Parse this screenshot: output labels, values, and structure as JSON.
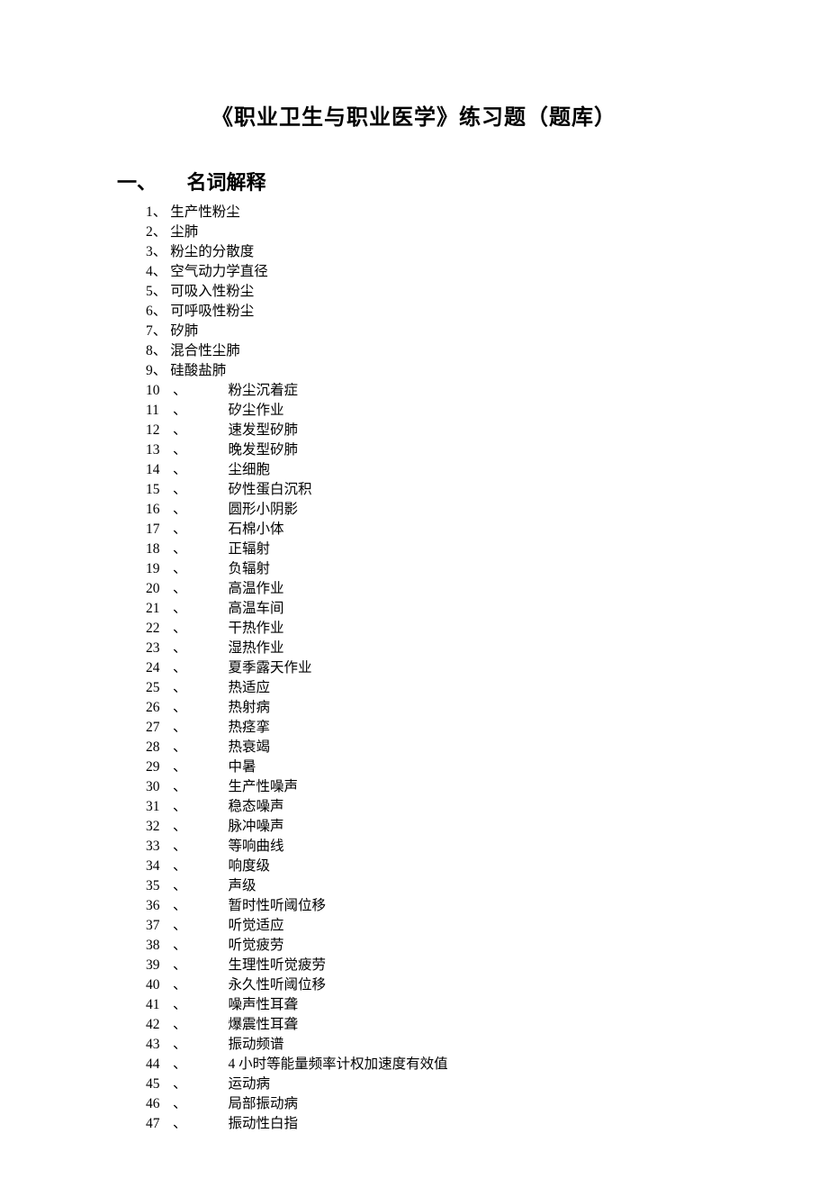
{
  "title": "《职业卫生与职业医学》练习题（题库）",
  "section": {
    "number": "一、",
    "label": "名词解释"
  },
  "items": [
    {
      "n": "1",
      "t": "生产性粉尘",
      "style": "a"
    },
    {
      "n": "2",
      "t": "尘肺",
      "style": "a"
    },
    {
      "n": "3",
      "t": "粉尘的分散度",
      "style": "a"
    },
    {
      "n": "4",
      "t": "空气动力学直径",
      "style": "a"
    },
    {
      "n": "5",
      "t": "可吸入性粉尘",
      "style": "a"
    },
    {
      "n": "6",
      "t": "可呼吸性粉尘",
      "style": "a"
    },
    {
      "n": "7",
      "t": "矽肺",
      "style": "a"
    },
    {
      "n": "8",
      "t": "混合性尘肺",
      "style": "a"
    },
    {
      "n": "9",
      "t": "硅酸盐肺",
      "style": "a"
    },
    {
      "n": "10",
      "t": "粉尘沉着症",
      "style": "b"
    },
    {
      "n": "11",
      "t": "矽尘作业",
      "style": "b"
    },
    {
      "n": "12",
      "t": "速发型矽肺",
      "style": "b"
    },
    {
      "n": "13",
      "t": "晚发型矽肺",
      "style": "b"
    },
    {
      "n": "14",
      "t": "尘细胞",
      "style": "b"
    },
    {
      "n": "15",
      "t": "矽性蛋白沉积",
      "style": "b"
    },
    {
      "n": "16",
      "t": "圆形小阴影",
      "style": "b"
    },
    {
      "n": "17",
      "t": "石棉小体",
      "style": "b"
    },
    {
      "n": "18",
      "t": "正辐射",
      "style": "b"
    },
    {
      "n": "19",
      "t": "负辐射",
      "style": "b"
    },
    {
      "n": "20",
      "t": "高温作业",
      "style": "b"
    },
    {
      "n": "21",
      "t": "高温车间",
      "style": "b"
    },
    {
      "n": "22",
      "t": "干热作业",
      "style": "b"
    },
    {
      "n": "23",
      "t": "湿热作业",
      "style": "b"
    },
    {
      "n": "24",
      "t": "夏季露天作业",
      "style": "b"
    },
    {
      "n": "25",
      "t": "热适应",
      "style": "b"
    },
    {
      "n": "26",
      "t": "热射病",
      "style": "b"
    },
    {
      "n": "27",
      "t": "热痉挛",
      "style": "b"
    },
    {
      "n": "28",
      "t": "热衰竭",
      "style": "b"
    },
    {
      "n": "29",
      "t": "中暑",
      "style": "b"
    },
    {
      "n": "30",
      "t": "生产性噪声",
      "style": "b"
    },
    {
      "n": "31",
      "t": "稳态噪声",
      "style": "b"
    },
    {
      "n": "32",
      "t": "脉冲噪声",
      "style": "b"
    },
    {
      "n": "33",
      "t": "等响曲线",
      "style": "b"
    },
    {
      "n": "34",
      "t": "响度级",
      "style": "b"
    },
    {
      "n": "35",
      "t": "声级",
      "style": "b"
    },
    {
      "n": "36",
      "t": "暂时性听阈位移",
      "style": "b"
    },
    {
      "n": "37",
      "t": "听觉适应",
      "style": "b"
    },
    {
      "n": "38",
      "t": "听觉疲劳",
      "style": "b"
    },
    {
      "n": "39",
      "t": "生理性听觉疲劳",
      "style": "b"
    },
    {
      "n": "40",
      "t": "永久性听阈位移",
      "style": "b"
    },
    {
      "n": "41",
      "t": "噪声性耳聋",
      "style": "b"
    },
    {
      "n": "42",
      "t": "爆震性耳聋",
      "style": "b"
    },
    {
      "n": "43",
      "t": "振动频谱",
      "style": "b"
    },
    {
      "n": "44",
      "t": "4 小时等能量频率计权加速度有效值",
      "style": "b"
    },
    {
      "n": "45",
      "t": "运动病",
      "style": "b"
    },
    {
      "n": "46",
      "t": "局部振动病",
      "style": "b"
    },
    {
      "n": "47",
      "t": "振动性白指",
      "style": "b"
    }
  ],
  "separator": "、"
}
